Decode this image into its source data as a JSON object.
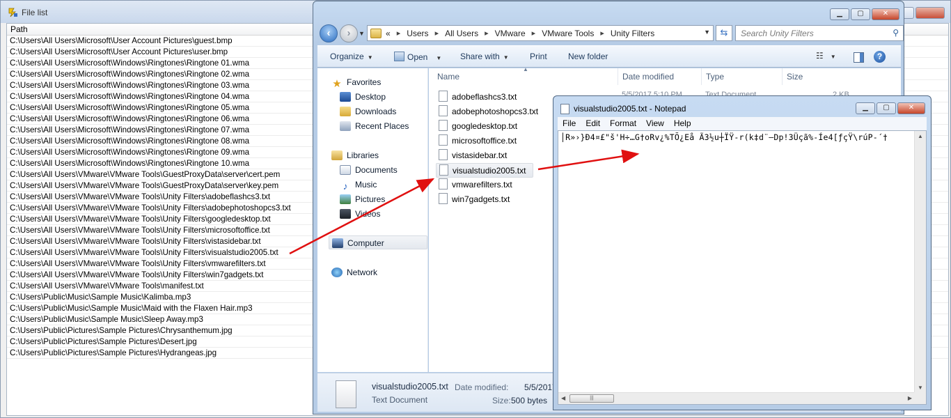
{
  "file_list_window": {
    "title": "File list",
    "column_header": "Path",
    "rows": [
      "C:\\Users\\All Users\\Microsoft\\User Account Pictures\\guest.bmp",
      "C:\\Users\\All Users\\Microsoft\\User Account Pictures\\user.bmp",
      "C:\\Users\\All Users\\Microsoft\\Windows\\Ringtones\\Ringtone 01.wma",
      "C:\\Users\\All Users\\Microsoft\\Windows\\Ringtones\\Ringtone 02.wma",
      "C:\\Users\\All Users\\Microsoft\\Windows\\Ringtones\\Ringtone 03.wma",
      "C:\\Users\\All Users\\Microsoft\\Windows\\Ringtones\\Ringtone 04.wma",
      "C:\\Users\\All Users\\Microsoft\\Windows\\Ringtones\\Ringtone 05.wma",
      "C:\\Users\\All Users\\Microsoft\\Windows\\Ringtones\\Ringtone 06.wma",
      "C:\\Users\\All Users\\Microsoft\\Windows\\Ringtones\\Ringtone 07.wma",
      "C:\\Users\\All Users\\Microsoft\\Windows\\Ringtones\\Ringtone 08.wma",
      "C:\\Users\\All Users\\Microsoft\\Windows\\Ringtones\\Ringtone 09.wma",
      "C:\\Users\\All Users\\Microsoft\\Windows\\Ringtones\\Ringtone 10.wma",
      "C:\\Users\\All Users\\VMware\\VMware Tools\\GuestProxyData\\server\\cert.pem",
      "C:\\Users\\All Users\\VMware\\VMware Tools\\GuestProxyData\\server\\key.pem",
      "C:\\Users\\All Users\\VMware\\VMware Tools\\Unity Filters\\adobeflashcs3.txt",
      "C:\\Users\\All Users\\VMware\\VMware Tools\\Unity Filters\\adobephotoshopcs3.txt",
      "C:\\Users\\All Users\\VMware\\VMware Tools\\Unity Filters\\googledesktop.txt",
      "C:\\Users\\All Users\\VMware\\VMware Tools\\Unity Filters\\microsoftoffice.txt",
      "C:\\Users\\All Users\\VMware\\VMware Tools\\Unity Filters\\vistasidebar.txt",
      "C:\\Users\\All Users\\VMware\\VMware Tools\\Unity Filters\\visualstudio2005.txt",
      "C:\\Users\\All Users\\VMware\\VMware Tools\\Unity Filters\\vmwarefilters.txt",
      "C:\\Users\\All Users\\VMware\\VMware Tools\\Unity Filters\\win7gadgets.txt",
      "C:\\Users\\All Users\\VMware\\VMware Tools\\manifest.txt",
      "C:\\Users\\Public\\Music\\Sample Music\\Kalimba.mp3",
      "C:\\Users\\Public\\Music\\Sample Music\\Maid with the Flaxen Hair.mp3",
      "C:\\Users\\Public\\Music\\Sample Music\\Sleep Away.mp3",
      "C:\\Users\\Public\\Pictures\\Sample Pictures\\Chrysanthemum.jpg",
      "C:\\Users\\Public\\Pictures\\Sample Pictures\\Desert.jpg",
      "C:\\Users\\Public\\Pictures\\Sample Pictures\\Hydrangeas.jpg"
    ]
  },
  "explorer": {
    "address_prefix": "«",
    "breadcrumbs": [
      "Users",
      "All Users",
      "VMware",
      "VMware Tools",
      "Unity Filters"
    ],
    "search_placeholder": "Search Unity Filters",
    "toolbar": {
      "organize": "Organize",
      "open": "Open",
      "share_with": "Share with",
      "print": "Print",
      "new_folder": "New folder"
    },
    "nav": {
      "favorites": "Favorites",
      "desktop": "Desktop",
      "downloads": "Downloads",
      "recent_places": "Recent Places",
      "libraries": "Libraries",
      "documents": "Documents",
      "music": "Music",
      "pictures": "Pictures",
      "videos": "Videos",
      "computer": "Computer",
      "network": "Network"
    },
    "columns": {
      "name": "Name",
      "date_modified": "Date modified",
      "type": "Type",
      "size": "Size"
    },
    "first_row_meta": {
      "date": "5/5/2017 5:10 PM",
      "type": "Text Document",
      "size": "2 KB"
    },
    "files": [
      "adobeflashcs3.txt",
      "adobephotoshopcs3.txt",
      "googledesktop.txt",
      "microsoftoffice.txt",
      "vistasidebar.txt",
      "visualstudio2005.txt",
      "vmwarefilters.txt",
      "win7gadgets.txt"
    ],
    "selected_file": "visualstudio2005.txt",
    "details": {
      "name": "visualstudio2005.txt",
      "type": "Text Document",
      "date_label": "Date modified:",
      "date_value": "5/5/2017 5:",
      "size_label": "Size:",
      "size_value": "500 bytes"
    }
  },
  "notepad": {
    "title": "visualstudio2005.txt - Notepad",
    "menu": [
      "File",
      "Edit",
      "Format",
      "View",
      "Help"
    ],
    "content": "│R»›}Ð4¤£\"š'H÷…G†oRv¿%TÕ¿Eå Ã3½u┼ÏŸ-r(k‡d¨—Dp!3Üçã%-Íe4[ƒçŸ\\rúP-´†"
  },
  "colors": {
    "titlebar": "#c7dbf2",
    "close_button": "#c6452a",
    "annotation_arrow": "#e01010"
  }
}
